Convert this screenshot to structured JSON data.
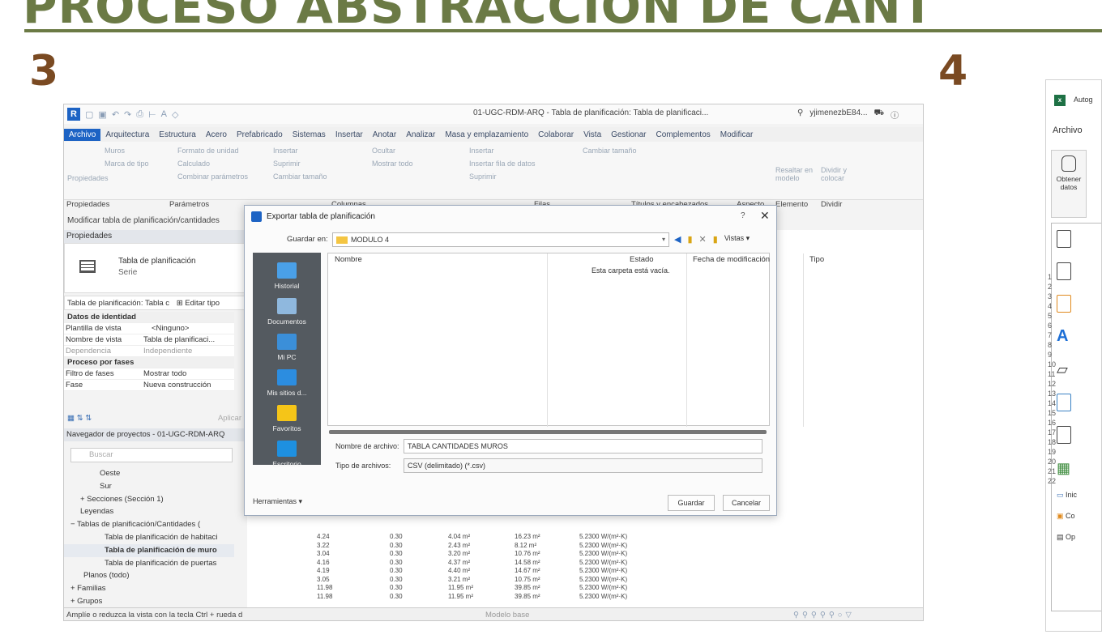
{
  "slide": {
    "title": "PROCESO ABSTRACCIÓN DE CANT",
    "step_left": "3",
    "step_right": "4"
  },
  "revit": {
    "doc_title": "01-UGC-RDM-ARQ - Tabla de planificación: Tabla de planificaci...",
    "user": "yjimenezbE84...",
    "menu": [
      "Archivo",
      "Arquitectura",
      "Estructura",
      "Acero",
      "Prefabricado",
      "Sistemas",
      "Insertar",
      "Anotar",
      "Analizar",
      "Masa y emplazamiento",
      "Colaborar",
      "Vista",
      "Gestionar",
      "Complementos",
      "Modificar"
    ],
    "ribbon": {
      "muros": "Muros",
      "marca_tipo": "Marca de tipo",
      "propiedades_btn": "Propiedades",
      "formato_unidad": "Formato de unidad",
      "calculado": "Calculado",
      "combinar": "Combinar parámetros",
      "insertar": "Insertar",
      "suprimir": "Suprimir",
      "cambiar_tamano": "Cambiar tamaño",
      "ocultar": "Ocultar",
      "mostrar_todo": "Mostrar todo",
      "insertar2": "Insertar",
      "insertar_fila": "Insertar fila de datos",
      "suprimir2": "Suprimir",
      "cambiar_tamano2": "Cambiar tamaño",
      "resaltar": "Resaltar en modelo",
      "dividir": "Dividir y colocar"
    },
    "groups": {
      "propiedades": "Propiedades",
      "parametros": "Parámetros",
      "columnas": "Columnas",
      "filas": "Filas",
      "titulos": "Títulos y encabezados",
      "aspecto": "Aspecto",
      "elemento": "Elemento",
      "dividir": "Dividir"
    },
    "context_line": "Modificar tabla de planificación/cantidades",
    "properties": {
      "header": "Propiedades",
      "type_name": "Tabla de planificación",
      "type_sub": "Serie",
      "instance_selector": "Tabla de planificación: Tabla c",
      "edit_type": "Editar tipo",
      "rows": [
        {
          "k": "Datos de identidad",
          "v": "",
          "section": true
        },
        {
          "k": "Plantilla de vista",
          "v": "<Ninguno>"
        },
        {
          "k": "Nombre de vista",
          "v": "Tabla de planificaci..."
        },
        {
          "k": "Dependencia",
          "v": "Independiente",
          "muted": true
        },
        {
          "k": "Proceso por fases",
          "v": "",
          "section": true
        },
        {
          "k": "Filtro de fases",
          "v": "Mostrar todo"
        },
        {
          "k": "Fase",
          "v": "Nueva construcción"
        }
      ],
      "apply": "Aplicar"
    },
    "navigator": {
      "header": "Navegador de proyectos - 01-UGC-RDM-ARQ",
      "search_placeholder": "Buscar",
      "items": [
        "Oeste",
        "Sur",
        "+ Secciones (Sección 1)",
        "Leyendas",
        "− Tablas de planificación/Cantidades (",
        "Tabla de planificación de habitaci",
        "Tabla de planificación de muro",
        "Tabla de planificación de puertas",
        "Planos (todo)",
        "+ Familias",
        "+ Grupos"
      ]
    },
    "status": {
      "left": "Amplíe o reduzca la vista con la tecla Ctrl + rueda d",
      "center": "Modelo base"
    },
    "schedule_rows": [
      [
        "4.24",
        "0.30",
        "4.04 m²",
        "16.23 m²",
        "5.2300 W/(m²·K)"
      ],
      [
        "3.22",
        "0.30",
        "2.43 m²",
        "8.12 m²",
        "5.2300 W/(m²·K)"
      ],
      [
        "3.04",
        "0.30",
        "3.20 m²",
        "10.76 m²",
        "5.2300 W/(m²·K)"
      ],
      [
        "4.16",
        "0.30",
        "4.37 m²",
        "14.58 m²",
        "5.2300 W/(m²·K)"
      ],
      [
        "4.19",
        "0.30",
        "4.40 m²",
        "14.67 m²",
        "5.2300 W/(m²·K)"
      ],
      [
        "3.05",
        "0.30",
        "3.21 m²",
        "10.75 m²",
        "5.2300 W/(m²·K)"
      ],
      [
        "11.98",
        "0.30",
        "11.95 m²",
        "39.85 m²",
        "5.2300 W/(m²·K)"
      ],
      [
        "11.98",
        "0.30",
        "11.95 m²",
        "39.85 m²",
        "5.2300 W/(m²·K)"
      ]
    ]
  },
  "dialog": {
    "title": "Exportar tabla de planificación",
    "help": "?",
    "close": "✕",
    "save_in_label": "Guardar en:",
    "save_in_value": "MODULO 4",
    "views_label": "Vistas",
    "places": [
      "Historial",
      "Documentos",
      "Mi PC",
      "Mis sitios d...",
      "Favoritos",
      "Escritorio"
    ],
    "columns": [
      "Nombre",
      "Estado",
      "Fecha de modificación",
      "Tipo"
    ],
    "empty_message": "Esta carpeta está vacía.",
    "file_name_label": "Nombre de archivo:",
    "file_name_value": "TABLA CANTIDADES MUROS",
    "file_type_label": "Tipo de archivos:",
    "file_type_value": "CSV (delimitado) (*.csv)",
    "tools": "Herramientas",
    "save": "Guardar",
    "cancel": "Cancelar"
  },
  "excel": {
    "title": "Autog",
    "archivo": "Archivo",
    "get_data_1": "Obtener",
    "get_data_2": "datos",
    "menu_items": [
      "Inic",
      "Co",
      "Op"
    ],
    "row_numbers": [
      "1",
      "2",
      "3",
      "4",
      "5",
      "6",
      "7",
      "8",
      "9",
      "10",
      "11",
      "12",
      "13",
      "14",
      "15",
      "16",
      "17",
      "18",
      "19",
      "20",
      "21",
      "22"
    ]
  }
}
